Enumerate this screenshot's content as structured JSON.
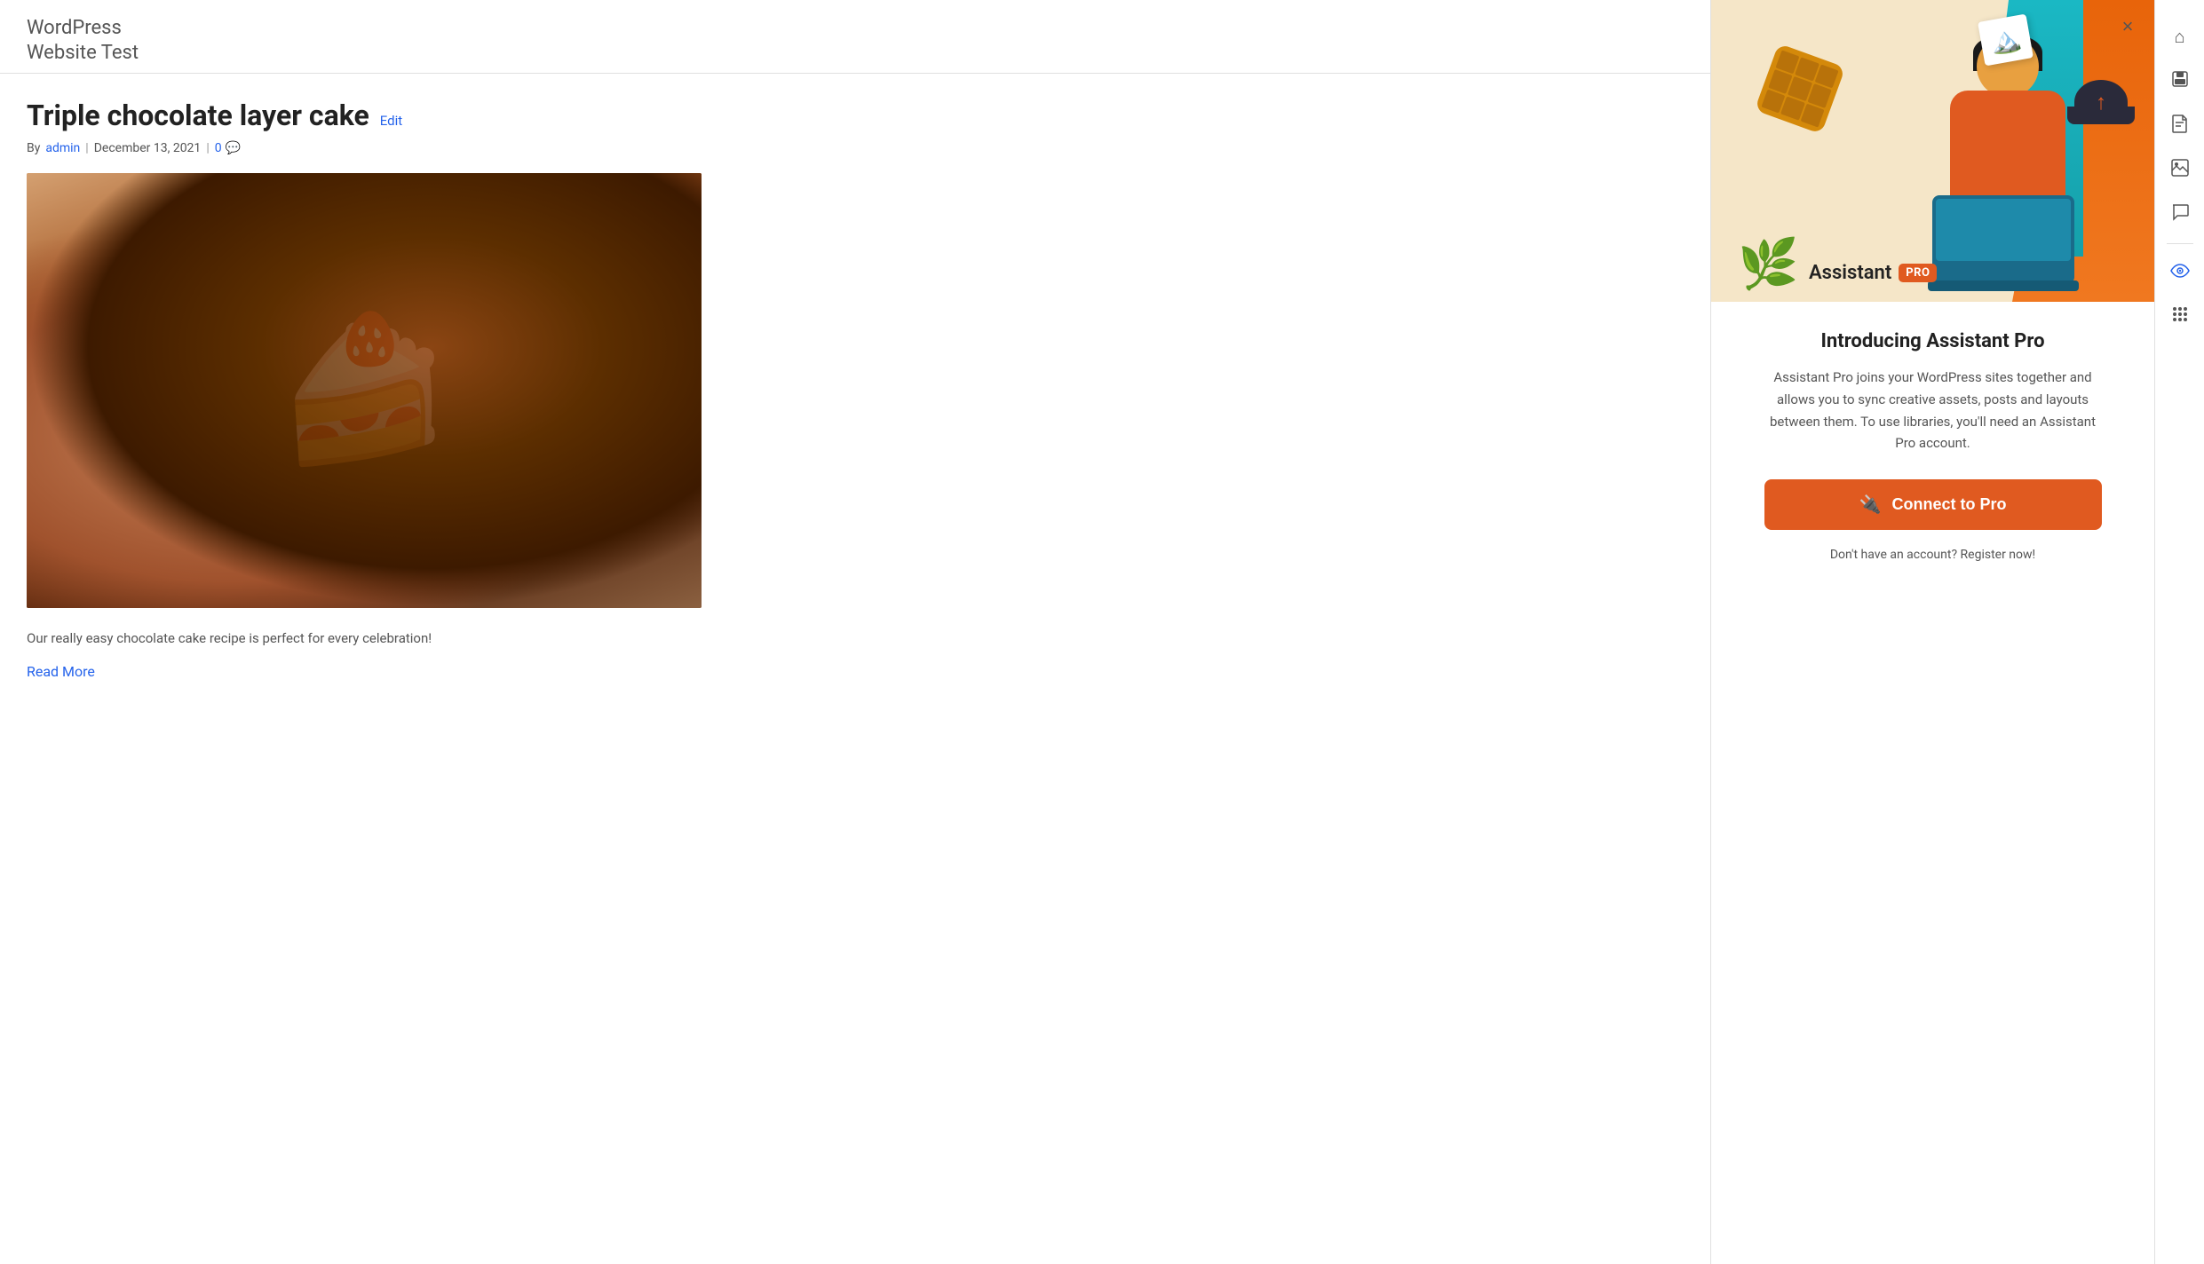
{
  "site": {
    "title_line1": "WordPress",
    "title_line2": "Website Test"
  },
  "post": {
    "title": "Triple chocolate layer cake",
    "edit_label": "Edit",
    "meta_by": "By",
    "meta_author": "admin",
    "meta_separator": "|",
    "meta_date": "December 13, 2021",
    "meta_comments": "0",
    "excerpt": "Our really easy chocolate cake recipe is perfect for every celebration!",
    "read_more_label": "Read More"
  },
  "assistant": {
    "close_label": "×",
    "badge_text": "Assistant",
    "pro_label": "PRO",
    "intro_title": "Introducing Assistant Pro",
    "intro_description": "Assistant Pro joins your WordPress sites together and allows you to sync creative assets, posts and layouts between them. To use libraries, you'll need an Assistant Pro account.",
    "connect_label": "Connect to Pro",
    "register_text": "Don't have an account? Register now!"
  },
  "sidebar_icons": {
    "home": "⌂",
    "save": "⬛",
    "page": "📄",
    "media": "🖼",
    "comments": "💬",
    "eye": "👁",
    "apps": "⠿"
  }
}
